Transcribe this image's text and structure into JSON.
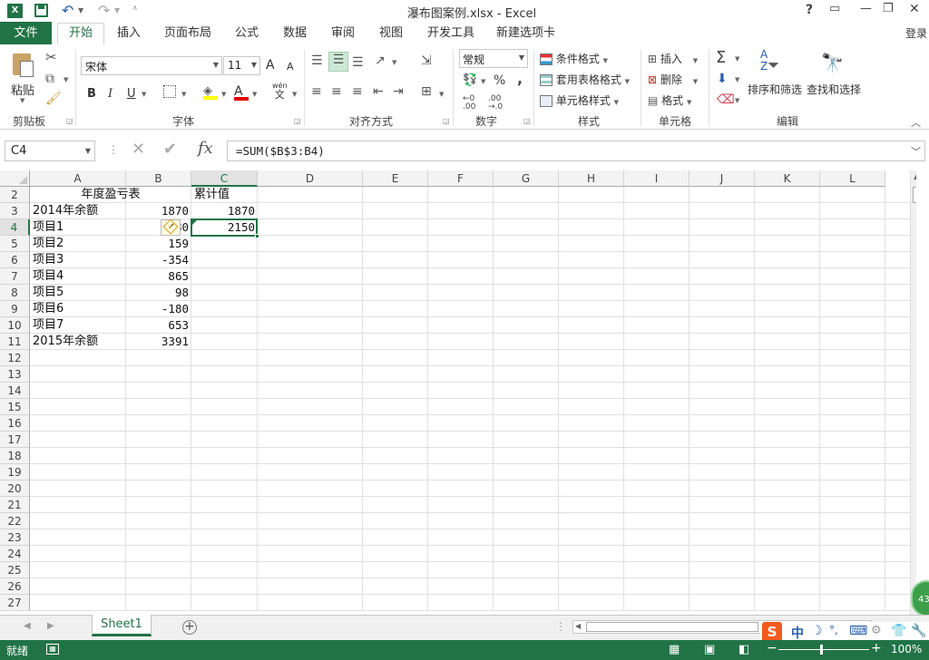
{
  "window": {
    "title": "瀑布图案例.xlsx - Excel",
    "help": "?",
    "restore_ribbon": "▭",
    "minimize": "—",
    "maximize": "❐",
    "close": "✕",
    "login": "登录"
  },
  "tabs": {
    "file": "文件",
    "items": [
      "开始",
      "插入",
      "页面布局",
      "公式",
      "数据",
      "审阅",
      "视图",
      "开发工具",
      "新建选项卡"
    ]
  },
  "ribbon": {
    "clipboard": {
      "paste": "粘贴",
      "label": "剪贴板"
    },
    "font": {
      "name": "宋体",
      "size": "11",
      "bold": "B",
      "italic": "I",
      "underline": "U",
      "grow": "A",
      "shrink": "A",
      "font_color": "A",
      "wen": "wén",
      "wen2": "文",
      "label": "字体"
    },
    "align": {
      "label": "对齐方式"
    },
    "number": {
      "format": "常规",
      "percent": "%",
      "comma": ",",
      "label": "数字"
    },
    "styles": {
      "cond": "条件格式",
      "table": "套用表格格式",
      "cell": "单元格样式",
      "label": "样式"
    },
    "cells": {
      "insert": "插入",
      "delete": "删除",
      "format": "格式",
      "label": "单元格"
    },
    "editing": {
      "sort": "排序和筛选",
      "find": "查找和选择",
      "label": "编辑"
    }
  },
  "formula_bar": {
    "name_box": "C4",
    "fx": "fx",
    "formula": "=SUM($B$3:B4)"
  },
  "sheet": {
    "columns": [
      "A",
      "B",
      "C",
      "D",
      "E",
      "F",
      "G",
      "H",
      "I",
      "J",
      "K",
      "L"
    ],
    "rows": [
      "2",
      "3",
      "4",
      "5",
      "6",
      "7",
      "8",
      "9",
      "10",
      "11",
      "12",
      "13",
      "14",
      "15",
      "16",
      "17",
      "18",
      "19",
      "20",
      "21",
      "22",
      "23",
      "24",
      "25",
      "26",
      "27"
    ],
    "cells": {
      "A2": "年度盈亏表",
      "C2": "累计值",
      "A3": "2014年余额",
      "B3": "1870",
      "C3": "1870",
      "A4": "项目1",
      "B4": "280",
      "C4": "2150",
      "A5": "项目2",
      "B5": "159",
      "A6": "项目3",
      "B6": "-354",
      "A7": "项目4",
      "B7": "865",
      "A8": "项目5",
      "B8": "98",
      "A9": "项目6",
      "B9": "-180",
      "A10": "项目7",
      "B10": "653",
      "A11": "2015年余额",
      "B11": "3391"
    },
    "warning_icon": "!"
  },
  "sheet_tabs": {
    "active": "Sheet1",
    "add": "+"
  },
  "status": {
    "ready": "就绪",
    "zoom": "100%"
  },
  "ime": {
    "logo": "S",
    "mode": "中",
    "moon": "☽",
    "dot": "°,",
    "badge": "43"
  }
}
